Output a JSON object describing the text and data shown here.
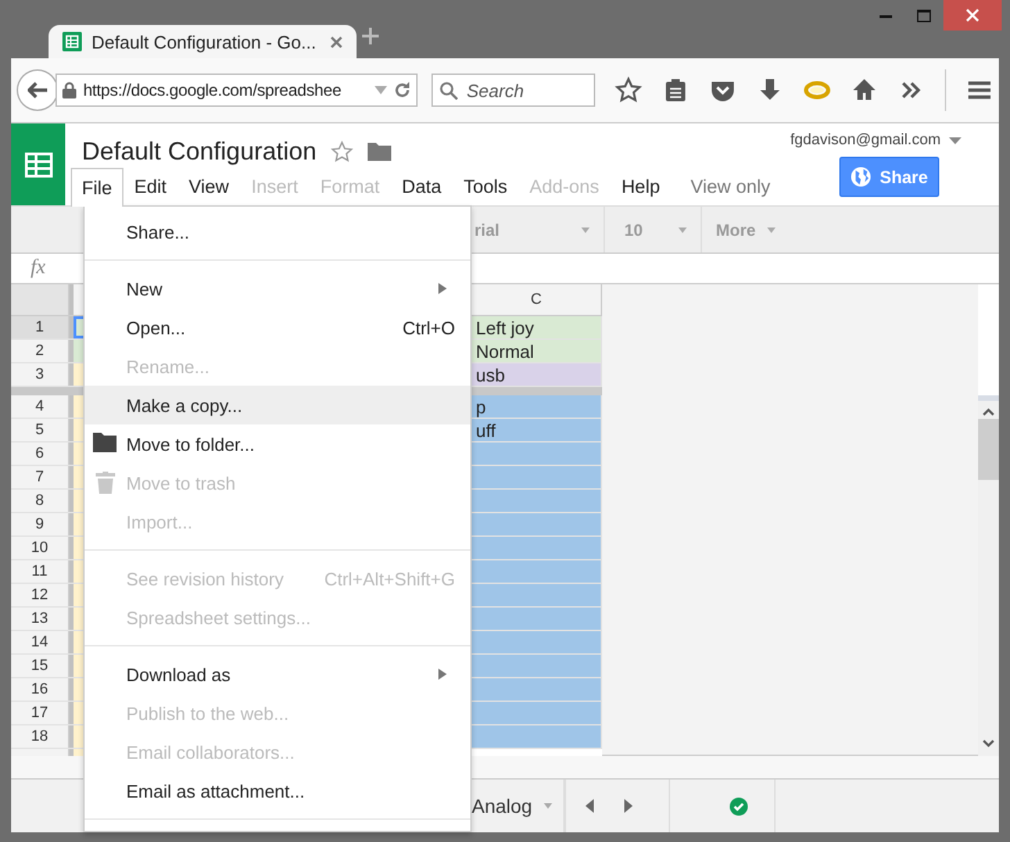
{
  "browser": {
    "tab_title": "Default Configuration - Go...",
    "url": "https://docs.google.com/spreadshee",
    "search_placeholder": "Search"
  },
  "document": {
    "title": "Default Configuration",
    "account": "fgdavison@gmail.com",
    "share_label": "Share",
    "status": "View only"
  },
  "menubar": [
    {
      "label": "File",
      "selected": true,
      "disabled": false
    },
    {
      "label": "Edit",
      "selected": false,
      "disabled": false
    },
    {
      "label": "View",
      "selected": false,
      "disabled": false
    },
    {
      "label": "Insert",
      "selected": false,
      "disabled": true
    },
    {
      "label": "Format",
      "selected": false,
      "disabled": true
    },
    {
      "label": "Data",
      "selected": false,
      "disabled": false
    },
    {
      "label": "Tools",
      "selected": false,
      "disabled": false
    },
    {
      "label": "Add-ons",
      "selected": false,
      "disabled": true
    },
    {
      "label": "Help",
      "selected": false,
      "disabled": false
    }
  ],
  "toolbar": {
    "font": "rial",
    "size": "10",
    "more": "More"
  },
  "formula_bar": {
    "label": "fx"
  },
  "grid": {
    "column": "C",
    "rows": [
      {
        "number": "1",
        "a": {
          "color": "#d9ead3",
          "selected": true
        },
        "c": {
          "text": "Left joy",
          "color": "#d9ead3"
        }
      },
      {
        "number": "2",
        "a": {
          "color": "#d9ead3",
          "selected": false
        },
        "c": {
          "text": "Normal",
          "color": "#d9ead3"
        }
      },
      {
        "number": "3",
        "a": {
          "color": "#fff2cc",
          "selected": false
        },
        "c": {
          "text": "usb",
          "color": "#d9d2e9"
        }
      },
      {
        "number": "4",
        "a": {
          "color": "#fff2cc",
          "selected": false
        },
        "c": {
          "text": "p",
          "color": "#9fc5e8"
        }
      },
      {
        "number": "5",
        "a": {
          "color": "#fff2cc",
          "selected": false
        },
        "c": {
          "text": "uff",
          "color": "#9fc5e8"
        }
      },
      {
        "number": "6",
        "a": {
          "color": "#fff2cc",
          "selected": false
        },
        "c": {
          "color": "#9fc5e8"
        }
      },
      {
        "number": "7",
        "a": {
          "color": "#fff2cc",
          "selected": false
        },
        "c": {
          "color": "#9fc5e8"
        }
      },
      {
        "number": "8",
        "a": {
          "color": "#fff2cc",
          "selected": false
        },
        "c": {
          "color": "#9fc5e8"
        }
      },
      {
        "number": "9",
        "a": {
          "color": "#fff2cc",
          "selected": false
        },
        "c": {
          "color": "#9fc5e8"
        }
      },
      {
        "number": "10",
        "a": {
          "color": "#fff2cc",
          "selected": false
        },
        "c": {
          "color": "#9fc5e8"
        }
      },
      {
        "number": "11",
        "a": {
          "color": "#fff2cc",
          "selected": false
        },
        "c": {
          "color": "#9fc5e8"
        }
      },
      {
        "number": "12",
        "a": {
          "color": "#fff2cc",
          "selected": false
        },
        "c": {
          "color": "#9fc5e8"
        }
      },
      {
        "number": "13",
        "a": {
          "color": "#fff2cc",
          "selected": false
        },
        "c": {
          "color": "#9fc5e8"
        }
      },
      {
        "number": "14",
        "a": {
          "color": "#fff2cc",
          "selected": false
        },
        "c": {
          "color": "#9fc5e8"
        }
      },
      {
        "number": "15",
        "a": {
          "color": "#fff2cc",
          "selected": false
        },
        "c": {
          "color": "#9fc5e8"
        }
      },
      {
        "number": "16",
        "a": {
          "color": "#fff2cc",
          "selected": false
        },
        "c": {
          "color": "#9fc5e8"
        }
      },
      {
        "number": "17",
        "a": {
          "color": "#fff2cc",
          "selected": false
        },
        "c": {
          "color": "#9fc5e8"
        }
      },
      {
        "number": "18",
        "a": {
          "color": "#fff2cc",
          "selected": false
        },
        "c": {
          "color": "#9fc5e8"
        }
      }
    ]
  },
  "sheet_tab": "Analog",
  "file_menu": [
    {
      "kind": "plain",
      "label": "Share...",
      "disabled": false,
      "selected": false
    },
    {
      "kind": "divider"
    },
    {
      "kind": "plain",
      "label": "New",
      "disabled": false,
      "selected": false,
      "submenu": true
    },
    {
      "kind": "plain",
      "label": "Open...",
      "shortcut": "Ctrl+O",
      "disabled": false,
      "selected": false
    },
    {
      "kind": "plain",
      "label": "Rename...",
      "disabled": true,
      "selected": false
    },
    {
      "kind": "plain",
      "label": "Make a copy...",
      "disabled": false,
      "selected": true
    },
    {
      "kind": "folder",
      "label": "Move to folder...",
      "disabled": false,
      "selected": false
    },
    {
      "kind": "trash",
      "label": "Move to trash",
      "disabled": true,
      "selected": false
    },
    {
      "kind": "plain",
      "label": "Import...",
      "disabled": true,
      "selected": false
    },
    {
      "kind": "divider"
    },
    {
      "kind": "plain",
      "label": "See revision history",
      "shortcut": "Ctrl+Alt+Shift+G",
      "disabled": true,
      "selected": false
    },
    {
      "kind": "plain",
      "label": "Spreadsheet settings...",
      "disabled": true,
      "selected": false
    },
    {
      "kind": "divider"
    },
    {
      "kind": "plain",
      "label": "Download as",
      "disabled": false,
      "selected": false,
      "submenu": true
    },
    {
      "kind": "plain",
      "label": "Publish to the web...",
      "disabled": true,
      "selected": false
    },
    {
      "kind": "plain",
      "label": "Email collaborators...",
      "disabled": true,
      "selected": false
    },
    {
      "kind": "plain",
      "label": "Email as attachment...",
      "disabled": false,
      "selected": false
    },
    {
      "kind": "divider"
    }
  ]
}
